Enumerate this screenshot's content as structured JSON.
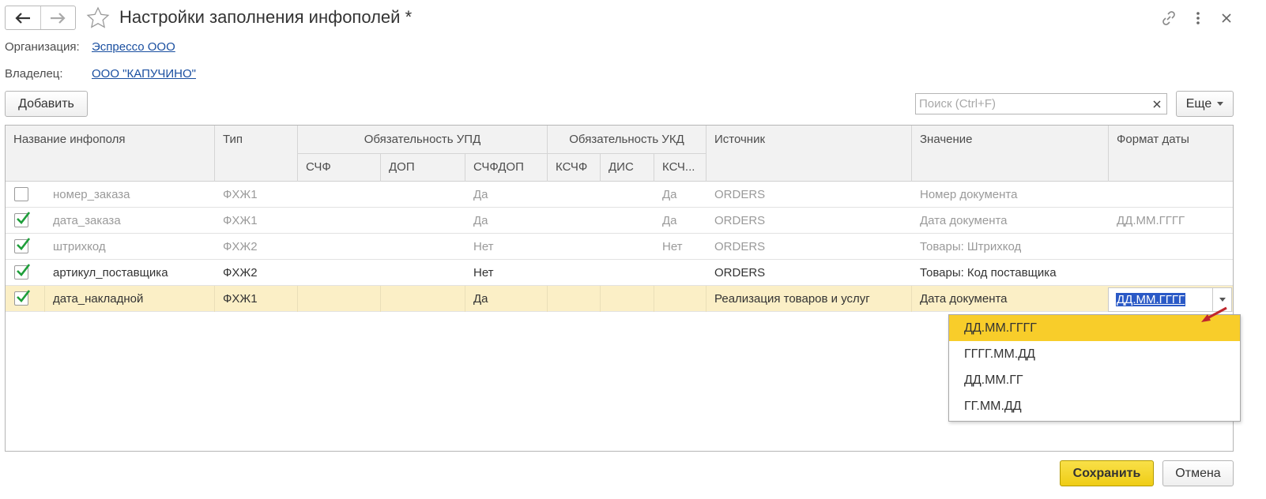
{
  "window": {
    "title": "Настройки заполнения инфополей *",
    "icons": {
      "back": "arrow-left-icon",
      "forward": "arrow-right-icon",
      "favorite": "star-icon",
      "link": "link-icon",
      "more": "more-vertical-icon",
      "close": "close-icon"
    }
  },
  "fields": {
    "organization": {
      "label": "Организация:",
      "value": "Эспрессо ООО"
    },
    "owner": {
      "label": "Владелец:",
      "value": "ООО \"КАПУЧИНО\""
    }
  },
  "toolbar": {
    "add_label": "Добавить",
    "search_placeholder": "Поиск (Ctrl+F)",
    "search_value": "",
    "more_label": "Еще"
  },
  "table": {
    "headers": {
      "name": "Название инфополя",
      "type": "Тип",
      "upd_group": "Обязательность УПД",
      "ukd_group": "Обязательность УКД",
      "source": "Источник",
      "value": "Значение",
      "date_format": "Формат даты",
      "sf": "СЧФ",
      "dop": "ДОП",
      "sfdop": "СЧФДОП",
      "ksf": "КСЧФ",
      "dis": "ДИС",
      "ksfdis": "КСЧ..."
    },
    "rows": [
      {
        "checked": false,
        "name": "номер_заказа",
        "type": "ФХЖ1",
        "sf": "",
        "dop": "",
        "sfdop": "Да",
        "ksf": "",
        "dis": "",
        "ksfdis": "Да",
        "source": "ORDERS",
        "value": "Номер документа",
        "date_format": ""
      },
      {
        "checked": true,
        "name": "дата_заказа",
        "type": "ФХЖ1",
        "sf": "",
        "dop": "",
        "sfdop": "Да",
        "ksf": "",
        "dis": "",
        "ksfdis": "Да",
        "source": "ORDERS",
        "value": "Дата документа",
        "date_format": "ДД.ММ.ГГГГ"
      },
      {
        "checked": true,
        "name": "штрихкод",
        "type": "ФХЖ2",
        "sf": "",
        "dop": "",
        "sfdop": "Нет",
        "ksf": "",
        "dis": "",
        "ksfdis": "Нет",
        "source": "ORDERS",
        "value": "Товары: Штрихкод",
        "date_format": ""
      },
      {
        "checked": true,
        "name": "артикул_поставщика",
        "type": "ФХЖ2",
        "sf": "",
        "dop": "",
        "sfdop": "Нет",
        "ksf": "",
        "dis": "",
        "ksfdis": "",
        "source": "ORDERS",
        "value": "Товары: Код поставщика",
        "date_format": ""
      },
      {
        "checked": true,
        "name": "дата_накладной",
        "type": "ФХЖ1",
        "sf": "",
        "dop": "",
        "sfdop": "Да",
        "ksf": "",
        "dis": "",
        "ksfdis": "",
        "source": "Реализация товаров и услуг",
        "value": "Дата документа",
        "date_format": "ДД.ММ.ГГГГ"
      }
    ],
    "editor_value": "ДД.ММ.ГГГГ"
  },
  "date_format_options": [
    "ДД.ММ.ГГГГ",
    "ГГГГ.ММ.ДД",
    "ДД.ММ.ГГ",
    "ГГ.ММ.ДД"
  ],
  "footer": {
    "save_label": "Сохранить",
    "cancel_label": "Отмена"
  },
  "colors": {
    "accent_yellow": "#f8cd2a",
    "selected_row": "#fbefc6",
    "link": "#1a4fa0",
    "selection": "#2a59c6",
    "check_green": "#1e9e3a"
  }
}
